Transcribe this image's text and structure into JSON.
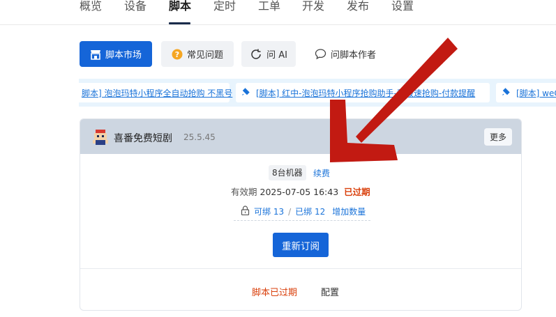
{
  "nav": {
    "items": [
      {
        "label": "概览"
      },
      {
        "label": "设备"
      },
      {
        "label": "脚本"
      },
      {
        "label": "定时"
      },
      {
        "label": "工单"
      },
      {
        "label": "开发"
      },
      {
        "label": "发布"
      },
      {
        "label": "设置"
      }
    ],
    "active": "脚本"
  },
  "actions": {
    "market": "脚本市场",
    "faq": "常见问题",
    "ask_ai": "问 AI",
    "ask_author": "问脚本作者"
  },
  "ticker": [
    {
      "text": "脚本] 泡泡玛特小程序全自动抢购 不黑号"
    },
    {
      "text": "[脚本] 红中-泡泡玛特小程序抢购助手-秒极速抢购-付款提醒"
    },
    {
      "text": "[脚本] weC"
    }
  ],
  "card": {
    "title": "喜番免费短剧",
    "version": "25.5.45",
    "more": "更多",
    "machines": "8台机器",
    "renew": "续费",
    "validity_label": "有效期",
    "validity_date": "2025-07-05 16:43",
    "expired_status": "已过期",
    "bindable": "可绑 13",
    "separator": "/",
    "bound": "已绑 12",
    "add_quantity": "增加数量",
    "resubscribe": "重新订阅",
    "footer_status": "脚本已过期",
    "footer_config": "配置"
  },
  "colors": {
    "primary": "#1565d8",
    "danger": "#d93f0b",
    "link": "#1a73d9",
    "card_header": "#cdd6e1",
    "arrow": "#c21a12"
  },
  "icons": [
    "store-icon",
    "question-icon",
    "ai-refresh-icon",
    "chat-icon",
    "bell-icon",
    "lock-icon",
    "robot-avatar"
  ]
}
